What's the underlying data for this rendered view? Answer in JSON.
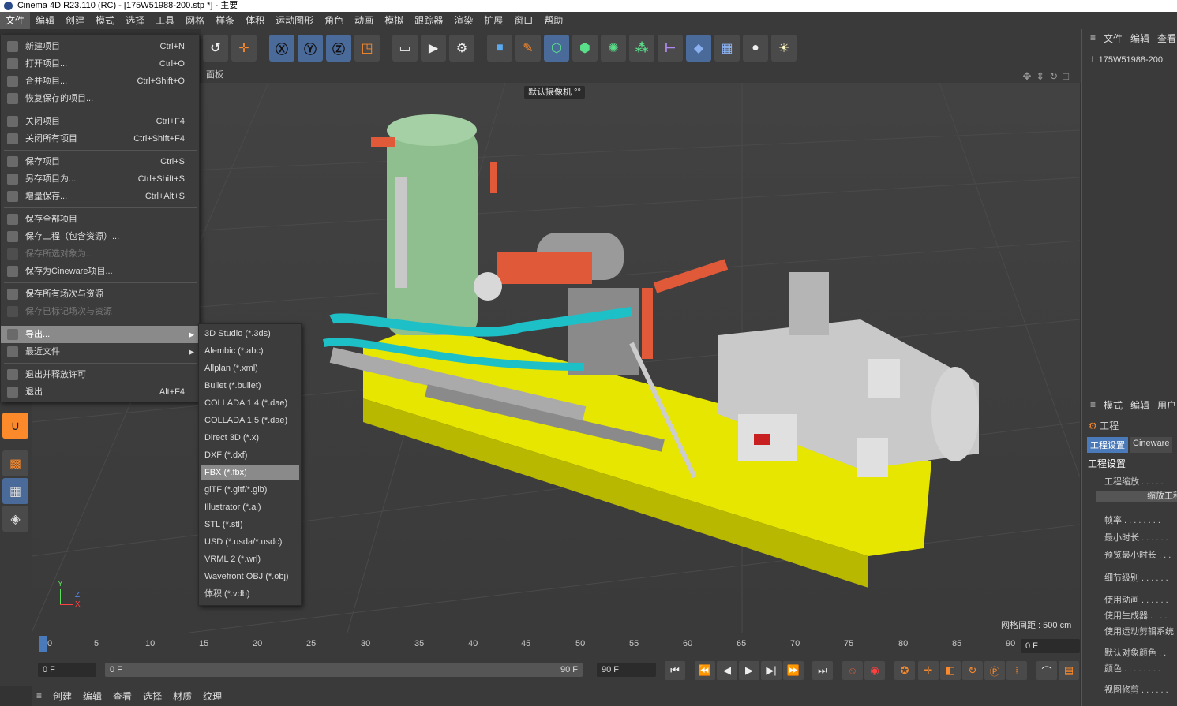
{
  "window": {
    "title": "Cinema 4D R23.110 (RC) - [175W51988-200.stp *] - 主要"
  },
  "menubar": [
    "文件",
    "编辑",
    "创建",
    "模式",
    "选择",
    "工具",
    "网格",
    "样条",
    "体积",
    "运动图形",
    "角色",
    "动画",
    "模拟",
    "跟踪器",
    "渲染",
    "扩展",
    "窗口",
    "帮助"
  ],
  "file_menu": [
    {
      "label": "新建项目",
      "shortcut": "Ctrl+N"
    },
    {
      "label": "打开项目...",
      "shortcut": "Ctrl+O"
    },
    {
      "label": "合并项目...",
      "shortcut": "Ctrl+Shift+O"
    },
    {
      "label": "恢复保存的项目...",
      "shortcut": ""
    },
    {
      "label": "关闭项目",
      "shortcut": "Ctrl+F4"
    },
    {
      "label": "关闭所有项目",
      "shortcut": "Ctrl+Shift+F4"
    },
    {
      "label": "保存项目",
      "shortcut": "Ctrl+S"
    },
    {
      "label": "另存项目为...",
      "shortcut": "Ctrl+Shift+S"
    },
    {
      "label": "增量保存...",
      "shortcut": "Ctrl+Alt+S"
    },
    {
      "label": "保存全部项目",
      "shortcut": ""
    },
    {
      "label": "保存工程（包含资源）...",
      "shortcut": ""
    },
    {
      "label": "保存所选对象为...",
      "shortcut": ""
    },
    {
      "label": "保存为Cineware项目...",
      "shortcut": ""
    },
    {
      "label": "保存所有场次与资源",
      "shortcut": ""
    },
    {
      "label": "保存已标记场次与资源",
      "shortcut": ""
    },
    {
      "label": "导出...",
      "shortcut": ""
    },
    {
      "label": "最近文件",
      "shortcut": ""
    },
    {
      "label": "退出并释放许可",
      "shortcut": ""
    },
    {
      "label": "退出",
      "shortcut": "Alt+F4"
    }
  ],
  "export_submenu": [
    "3D Studio (*.3ds)",
    "Alembic (*.abc)",
    "Allplan (*.xml)",
    "Bullet (*.bullet)",
    "COLLADA 1.4 (*.dae)",
    "COLLADA 1.5 (*.dae)",
    "Direct 3D (*.x)",
    "DXF (*.dxf)",
    "FBX (*.fbx)",
    "glTF (*.gltf/*.glb)",
    "Illustrator (*.ai)",
    "STL (*.stl)",
    "USD (*.usda/*.usdc)",
    "VRML 2 (*.wrl)",
    "Wavefront OBJ (*.obj)",
    "体积 (*.vdb)"
  ],
  "viewport": {
    "panel_label": "面板",
    "camera": "默认摄像机 °°",
    "grid_spacing": "网格间距 : 500 cm",
    "axis": {
      "y": "Y",
      "z": "Z",
      "x": "X"
    }
  },
  "timeline": {
    "ticks": [
      "0",
      "5",
      "10",
      "15",
      "20",
      "25",
      "30",
      "35",
      "40",
      "45",
      "50",
      "55",
      "60",
      "65",
      "70",
      "75",
      "80",
      "85",
      "90"
    ],
    "current_frame": "0 F",
    "start": "0 F",
    "slider_start": "0 F",
    "slider_end": "90 F",
    "end": "90 F"
  },
  "bottom_menu": [
    "创建",
    "编辑",
    "查看",
    "选择",
    "材质",
    "纹理"
  ],
  "object_manager": {
    "menu": [
      "文件",
      "编辑",
      "查看"
    ],
    "object": "175W51988-200"
  },
  "attribute_manager": {
    "menu": [
      "模式",
      "编辑",
      "用户"
    ],
    "title": "工程",
    "tabs": [
      "工程设置",
      "Cineware"
    ],
    "section": "工程设置",
    "rows": [
      "工程缩放 . . . . .",
      "帧率 . . . . . . . .",
      "最小时长 . . . . . .",
      "预览最小时长 . . .",
      "细节级别 . . . . . .",
      "使用动画 . . . . . .",
      "使用生成器 . . . .",
      "使用运动剪辑系统",
      "默认对象颜色 . .",
      "颜色 . . . . . . . .",
      "视图修剪 . . . . . ."
    ],
    "button": "缩放工程"
  },
  "colors": {
    "accent": "#4a7ab9",
    "menu_highlight": "#8a8a8a"
  }
}
